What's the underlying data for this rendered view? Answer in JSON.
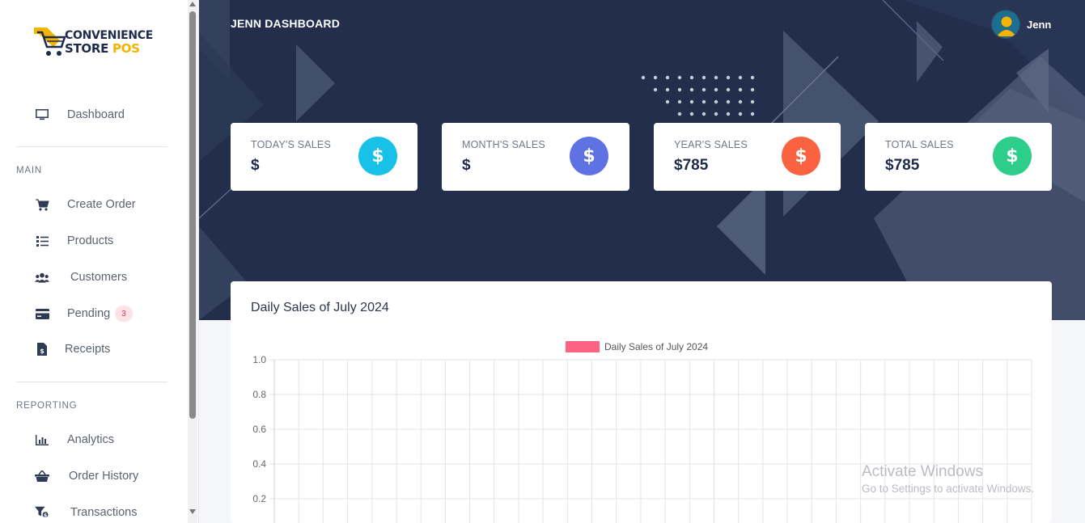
{
  "app": {
    "logo_line1": "CONVENIENCE",
    "logo_line2_a": "STORE ",
    "logo_line2_b": "POS"
  },
  "sidebar": {
    "dashboard_label": "Dashboard",
    "section_main": "MAIN",
    "section_reporting": "REPORTING",
    "items": [
      {
        "label": "Create Order",
        "icon": "cart-icon"
      },
      {
        "label": "Products",
        "icon": "list-icon"
      },
      {
        "label": "Customers",
        "icon": "users-icon"
      },
      {
        "label": "Pending",
        "icon": "card-icon",
        "badge": "3"
      },
      {
        "label": "Receipts",
        "icon": "receipt-icon"
      },
      {
        "label": "Analytics",
        "icon": "bar-chart-icon"
      },
      {
        "label": "Order History",
        "icon": "basket-icon"
      },
      {
        "label": "Transactions",
        "icon": "filter-dollar-icon"
      }
    ]
  },
  "header": {
    "title": "JENN DASHBOARD",
    "user_name": "Jenn"
  },
  "cards": [
    {
      "label": "TODAY'S SALES",
      "value": "$",
      "icon_symbol": "$",
      "color": "#17c1e8"
    },
    {
      "label": "MONTH'S SALES",
      "value": "$",
      "icon_symbol": "$",
      "color": "#5e72e4"
    },
    {
      "label": "YEAR'S SALES",
      "value": "$785",
      "icon_symbol": "$",
      "color": "#fb6340"
    },
    {
      "label": "TOTAL SALES",
      "value": "$785",
      "icon_symbol": "$",
      "color": "#2dce89"
    }
  ],
  "chart_card": {
    "title": "Daily Sales of July 2024"
  },
  "chart_data": {
    "type": "bar",
    "legend": [
      {
        "name": "Daily Sales of July 2024",
        "color": "#ff6384"
      }
    ],
    "legend_position": "top-center",
    "series": [
      {
        "name": "Daily Sales of July 2024",
        "values": []
      }
    ],
    "y_ticks": [
      "1.0",
      "0.8",
      "0.6",
      "0.4",
      "0.2"
    ],
    "ylim": [
      0,
      1.0
    ],
    "grid": true,
    "vertical_gridlines": 31
  },
  "watermark": {
    "line1": "Activate Windows",
    "line2": "Go to Settings to activate Windows."
  }
}
